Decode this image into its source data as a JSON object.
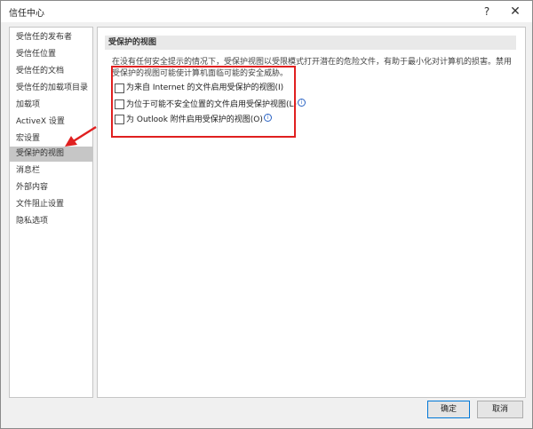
{
  "window": {
    "title": "信任中心",
    "help_glyph": "?",
    "close_glyph": "✕"
  },
  "sidebar": {
    "items": [
      {
        "label": "受信任的发布者"
      },
      {
        "label": "受信任位置"
      },
      {
        "label": "受信任的文档"
      },
      {
        "label": "受信任的加载项目录"
      },
      {
        "label": "加载项"
      },
      {
        "label": "ActiveX 设置"
      },
      {
        "label": "宏设置"
      },
      {
        "label": "受保护的视图",
        "selected": true
      },
      {
        "label": "消息栏"
      },
      {
        "label": "外部内容"
      },
      {
        "label": "文件阻止设置"
      },
      {
        "label": "隐私选项"
      }
    ]
  },
  "content": {
    "section_title": "受保护的视图",
    "description": "在没有任何安全提示的情况下，受保护视图以受限模式打开潜在的危险文件，有助于最小化对计算机的损害。禁用受保护的视图可能使计算机面临可能的安全威胁。",
    "options": [
      {
        "label": "为来自 Internet 的文件启用受保护的视图(I)",
        "checked": false,
        "info": false
      },
      {
        "label": "为位于可能不安全位置的文件启用受保护视图(L)",
        "checked": false,
        "info": true
      },
      {
        "label": "为 Outlook 附件启用受保护的视图(O)",
        "checked": false,
        "info": true
      }
    ],
    "info_glyph": "i"
  },
  "footer": {
    "ok_label": "确定",
    "cancel_label": "取消"
  },
  "annotation": {
    "color": "#e02020"
  }
}
